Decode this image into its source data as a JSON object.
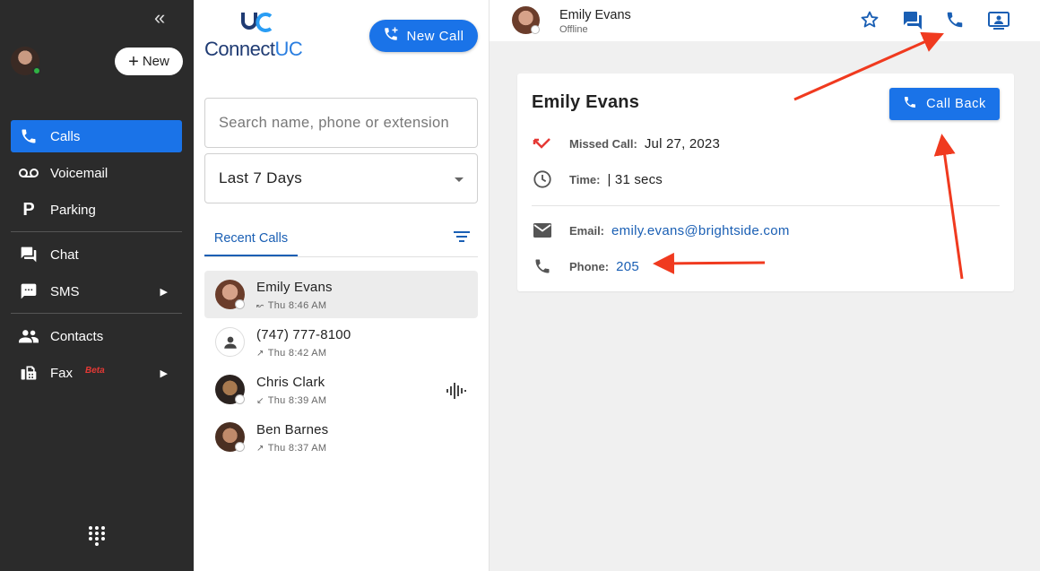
{
  "sidebar": {
    "new_label": "New",
    "nav": [
      {
        "label": "Calls",
        "active": true
      },
      {
        "label": "Voicemail"
      },
      {
        "label": "Parking"
      },
      {
        "label": "Chat"
      },
      {
        "label": "SMS"
      },
      {
        "label": "Contacts"
      },
      {
        "label": "Fax",
        "badge": "Beta"
      }
    ]
  },
  "logo": {
    "brand_prefix": "Connect",
    "brand_suffix": "UC"
  },
  "middle": {
    "new_call_label": "New Call",
    "search_placeholder": "Search name, phone or extension",
    "range_value": "Last 7 Days",
    "tab_recent": "Recent Calls",
    "calls": [
      {
        "name": "Emily Evans",
        "direction": "↜",
        "time": "Thu 8:46 AM",
        "selected": true
      },
      {
        "name": "(747) 777-8100",
        "direction": "↗",
        "time": "Thu 8:42 AM"
      },
      {
        "name": "Chris Clark",
        "direction": "↙",
        "time": "Thu 8:39 AM",
        "voicemail": true
      },
      {
        "name": "Ben Barnes",
        "direction": "↗",
        "time": "Thu 8:37 AM"
      }
    ]
  },
  "detail": {
    "header_name": "Emily Evans",
    "header_status": "Offline",
    "title": "Emily Evans",
    "call_back_label": "Call Back",
    "missed_label": "Missed Call:",
    "missed_value": "Jul 27, 2023",
    "time_label": "Time:",
    "time_value": "| 31 secs",
    "email_label": "Email:",
    "email_value": "emily.evans@brightside.com",
    "phone_label": "Phone:",
    "phone_value": "205"
  },
  "colors": {
    "accent": "#1a73e8",
    "sidebar_bg": "#2b2b2b",
    "annotation_arrow": "#f03a1f",
    "missed_red": "#e53935"
  }
}
